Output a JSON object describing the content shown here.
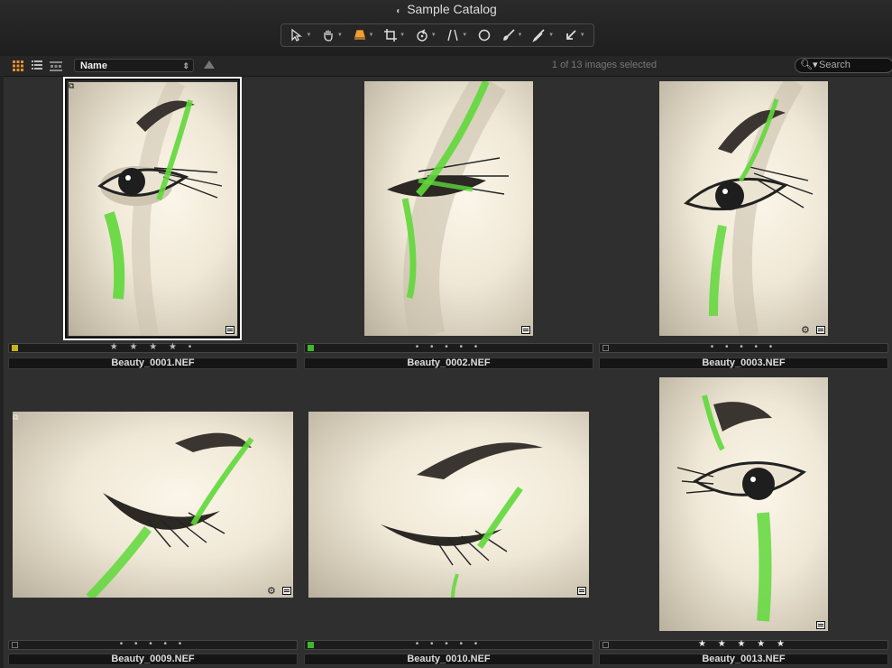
{
  "window": {
    "title": "Sample Catalog"
  },
  "toolbar": {
    "tools": [
      {
        "name": "select-tool-icon"
      },
      {
        "name": "hand-tool-icon"
      },
      {
        "name": "lamp-tool-icon",
        "active": true
      },
      {
        "name": "crop-tool-icon"
      },
      {
        "name": "rotate-tool-icon"
      },
      {
        "name": "straighten-tool-icon"
      },
      {
        "name": "circle-tool-icon"
      },
      {
        "name": "brush-tool-icon"
      },
      {
        "name": "eyedropper-tool-icon"
      },
      {
        "name": "arrow-tool-icon"
      }
    ],
    "accent": "#f0a030"
  },
  "browser": {
    "sort_by": "Name",
    "selection_status": "1 of 13 images selected",
    "search_placeholder": "Search",
    "grid_active_color": "#e8902a"
  },
  "images": [
    {
      "filename": "Beauty_0001.NEF",
      "rating": "★ ★ ★ ★ •",
      "label_color": "#c9b21c",
      "selected": true
    },
    {
      "filename": "Beauty_0002.NEF",
      "rating": "• • • • •",
      "label_color": "#3fb82a",
      "selected": false
    },
    {
      "filename": "Beauty_0003.NEF",
      "rating": "• • • • •",
      "label_color": "",
      "selected": false
    },
    {
      "filename": "Beauty_0009.NEF",
      "rating": "• • • • •",
      "label_color": "",
      "selected": false
    },
    {
      "filename": "Beauty_0010.NEF",
      "rating": "• • • • •",
      "label_color": "#3fb82a",
      "selected": false
    },
    {
      "filename": "Beauty_0013.NEF",
      "rating": "★ ★ ★ ★ ★",
      "label_color": "",
      "selected": false
    }
  ]
}
